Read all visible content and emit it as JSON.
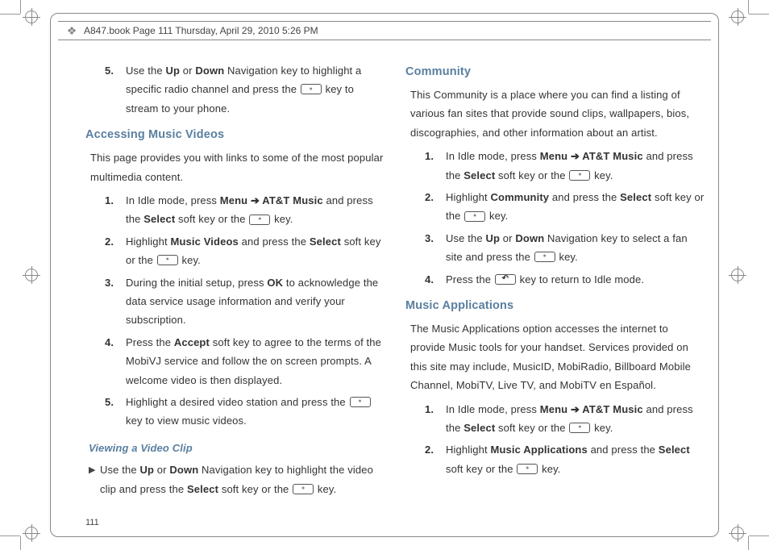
{
  "meta": {
    "header": "A847.book  Page 111  Thursday, April 29, 2010  5:26 PM",
    "page_number": "111"
  },
  "left": {
    "step5": {
      "num": "5.",
      "pre": "Use the ",
      "b1": "Up",
      "mid1": " or ",
      "b2": "Down",
      "mid2": " Navigation key to highlight a specific radio channel and press the ",
      "post": " key to stream to your phone."
    },
    "h_videos": "Accessing Music Videos",
    "videos_intro": "This page provides you with links to some of the most popular multimedia content.",
    "v1": {
      "num": "1.",
      "pre": "In Idle mode, press ",
      "b1": "Menu",
      "mid1": " ➔ ",
      "b2": "AT&T Music",
      "mid2": " and press the ",
      "b3": "Select",
      "mid3": " soft key or the ",
      "post": " key."
    },
    "v2": {
      "num": "2.",
      "pre": "Highlight ",
      "b1": "Music Videos",
      "mid1": " and press the ",
      "b2": "Select",
      "mid2": " soft key or the ",
      "post": " key."
    },
    "v3": {
      "num": "3.",
      "pre": "During the initial setup, press ",
      "b1": "OK",
      "post": " to acknowledge the data service usage information and verify your subscription."
    },
    "v4": {
      "num": "4.",
      "pre": "Press the ",
      "b1": "Accept",
      "post": " soft key to agree to the terms of the MobiVJ service and follow the on screen prompts. A welcome video is then displayed."
    },
    "v5": {
      "num": "5.",
      "pre": "Highlight a desired video station and press the ",
      "post": " key to view music videos."
    },
    "h_clip": "Viewing a Video Clip",
    "clip": {
      "pre": "Use the ",
      "b1": "Up",
      "mid1": " or ",
      "b2": "Down",
      "mid2": " Navigation key to highlight the video clip and press the ",
      "b3": "Select",
      "mid3": " soft key or the ",
      "post": " key."
    }
  },
  "right": {
    "h_comm": "Community",
    "comm_intro": "This Community is a place where you can find a listing of various fan sites that provide sound clips, wallpapers, bios, discographies, and other information about an artist.",
    "c1": {
      "num": "1.",
      "pre": "In Idle mode, press ",
      "b1": "Menu",
      "mid1": " ➔ ",
      "b2": "AT&T Music",
      "mid2": " and press the ",
      "b3": "Select",
      "mid3": " soft key or the ",
      "post": " key."
    },
    "c2": {
      "num": "2.",
      "pre": "Highlight ",
      "b1": "Community",
      "mid1": " and press the ",
      "b2": "Select",
      "mid2": " soft key or the ",
      "post": " key."
    },
    "c3": {
      "num": "3.",
      "pre": "Use the ",
      "b1": "Up",
      "mid1": " or ",
      "b2": "Down",
      "mid2": " Navigation key to select a fan site and press the ",
      "post": " key."
    },
    "c4": {
      "num": "4.",
      "pre": "Press the ",
      "post": " key to return to Idle mode."
    },
    "h_apps": "Music Applications",
    "apps_intro": "The Music Applications option accesses the internet to provide Music tools for your handset. Services provided on this site may include, MusicID, MobiRadio, Billboard Mobile Channel, MobiTV, Live TV, and MobiTV en Español.",
    "a1": {
      "num": "1.",
      "pre": "In Idle mode, press ",
      "b1": "Menu",
      "mid1": " ➔ ",
      "b2": "AT&T Music",
      "mid2": " and press the ",
      "b3": "Select",
      "mid3": " soft key or the ",
      "post": " key."
    },
    "a2": {
      "num": "2.",
      "pre": "Highlight ",
      "b1": "Music Applications",
      "mid1": " and press the ",
      "b2": "Select",
      "mid2": " soft key or the ",
      "post": " key."
    }
  }
}
